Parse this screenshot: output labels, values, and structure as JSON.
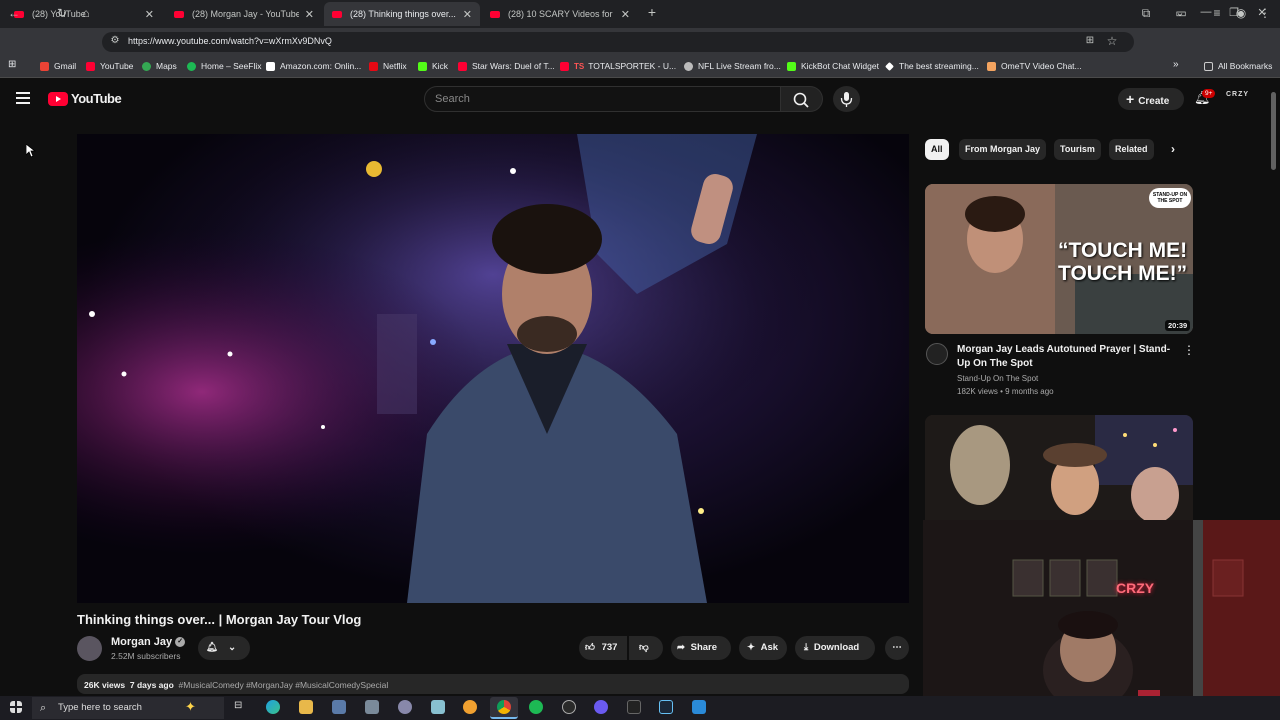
{
  "browser": {
    "tabs": [
      {
        "title": "(28) YouTube",
        "active": false
      },
      {
        "title": "(28) Morgan Jay - YouTube",
        "active": false
      },
      {
        "title": "(28) Thinking things over... | Mo",
        "active": true
      },
      {
        "title": "(28) 10 SCARY Videos for NO S",
        "active": false
      }
    ],
    "new_tab": "+",
    "url": "https://www.youtube.com/watch?v=wXrmXv9DNvQ",
    "bookmarks": [
      {
        "label": "Gmail",
        "color": "#ea4335"
      },
      {
        "label": "YouTube",
        "color": "#ff0033"
      },
      {
        "label": "Maps",
        "color": "#34a853"
      },
      {
        "label": "Home – SeeFlix",
        "color": "#1db954"
      },
      {
        "label": "Amazon.com: Onlin...",
        "color": "#ffffff"
      },
      {
        "label": "Netflix",
        "color": "#e50914"
      },
      {
        "label": "Kick",
        "color": "#53fc18"
      },
      {
        "label": "Star Wars: Duel of T...",
        "color": "#ff0033"
      },
      {
        "label": "TOTALSPORTEK - U...",
        "color": "#ff0033"
      },
      {
        "label": "NFL Live Stream fro...",
        "color": "#bbbbbb"
      },
      {
        "label": "KickBot Chat Widget",
        "color": "#53fc18"
      },
      {
        "label": "The best streaming...",
        "color": "#ffffff"
      },
      {
        "label": "OmeTV Video Chat...",
        "color": "#f4a460"
      }
    ],
    "all_bookmarks": "All Bookmarks"
  },
  "youtube": {
    "logo_text": "YouTube",
    "search_placeholder": "Search",
    "create_label": "Create",
    "notif_badge": "9+",
    "avatar_text": "CRZY",
    "video": {
      "title": "Thinking things over... | Morgan Jay Tour Vlog",
      "channel": "Morgan Jay",
      "subscribers": "2.52M subscribers",
      "likes": "737",
      "share": "Share",
      "ask": "Ask",
      "download": "Download",
      "views": "26K views",
      "age": "7 days ago",
      "tags": "#MusicalComedy #MorganJay #MusicalComedySpecial"
    },
    "chips": [
      "All",
      "From Morgan Jay",
      "Tourism",
      "Related"
    ],
    "recommendations": [
      {
        "title": "Morgan Jay Leads Autotuned Prayer | Stand-Up On The Spot",
        "channel": "Stand-Up On The Spot",
        "meta": "182K views • 9 months ago",
        "duration": "20:39",
        "thumb_text_1": "“TOUCH ME!",
        "thumb_text_2": "TOUCH ME!”",
        "thumb_badge": "STAND-UP ON THE SPOT"
      }
    ],
    "webcam_sign": "CRZY"
  },
  "taskbar": {
    "search_placeholder": "Type here to search"
  }
}
